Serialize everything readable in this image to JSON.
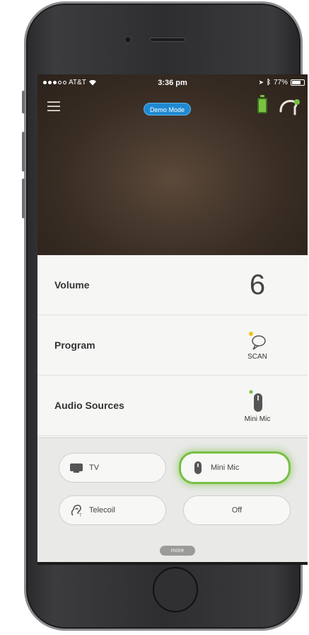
{
  "status_bar": {
    "carrier": "AT&T",
    "time": "3:36 pm",
    "battery_percent": "77%",
    "battery_level": 0.77
  },
  "header": {
    "menu_icon": "hamburger-menu-icon",
    "badge": "Demo Mode",
    "battery_icon": "hearing-aid-battery-icon",
    "device_icon": "hearing-aid-icon",
    "badge_color": "#1f8ad1",
    "accent_color": "#77c041"
  },
  "settings": {
    "volume": {
      "label": "Volume",
      "value": "6"
    },
    "program": {
      "label": "Program",
      "value": "SCAN",
      "icon": "speech-bubble-icon"
    },
    "audio_sources": {
      "label": "Audio Sources",
      "value": "Mini Mic",
      "icon": "mini-mic-icon"
    }
  },
  "sources": {
    "tv": {
      "label": "TV",
      "icon": "tv-icon"
    },
    "mini_mic": {
      "label": "Mini Mic",
      "icon": "mini-mic-icon",
      "active": true
    },
    "telecoil": {
      "label": "Telecoil",
      "icon": "telecoil-ear-icon"
    },
    "off": {
      "label": "Off"
    },
    "more": "more"
  }
}
